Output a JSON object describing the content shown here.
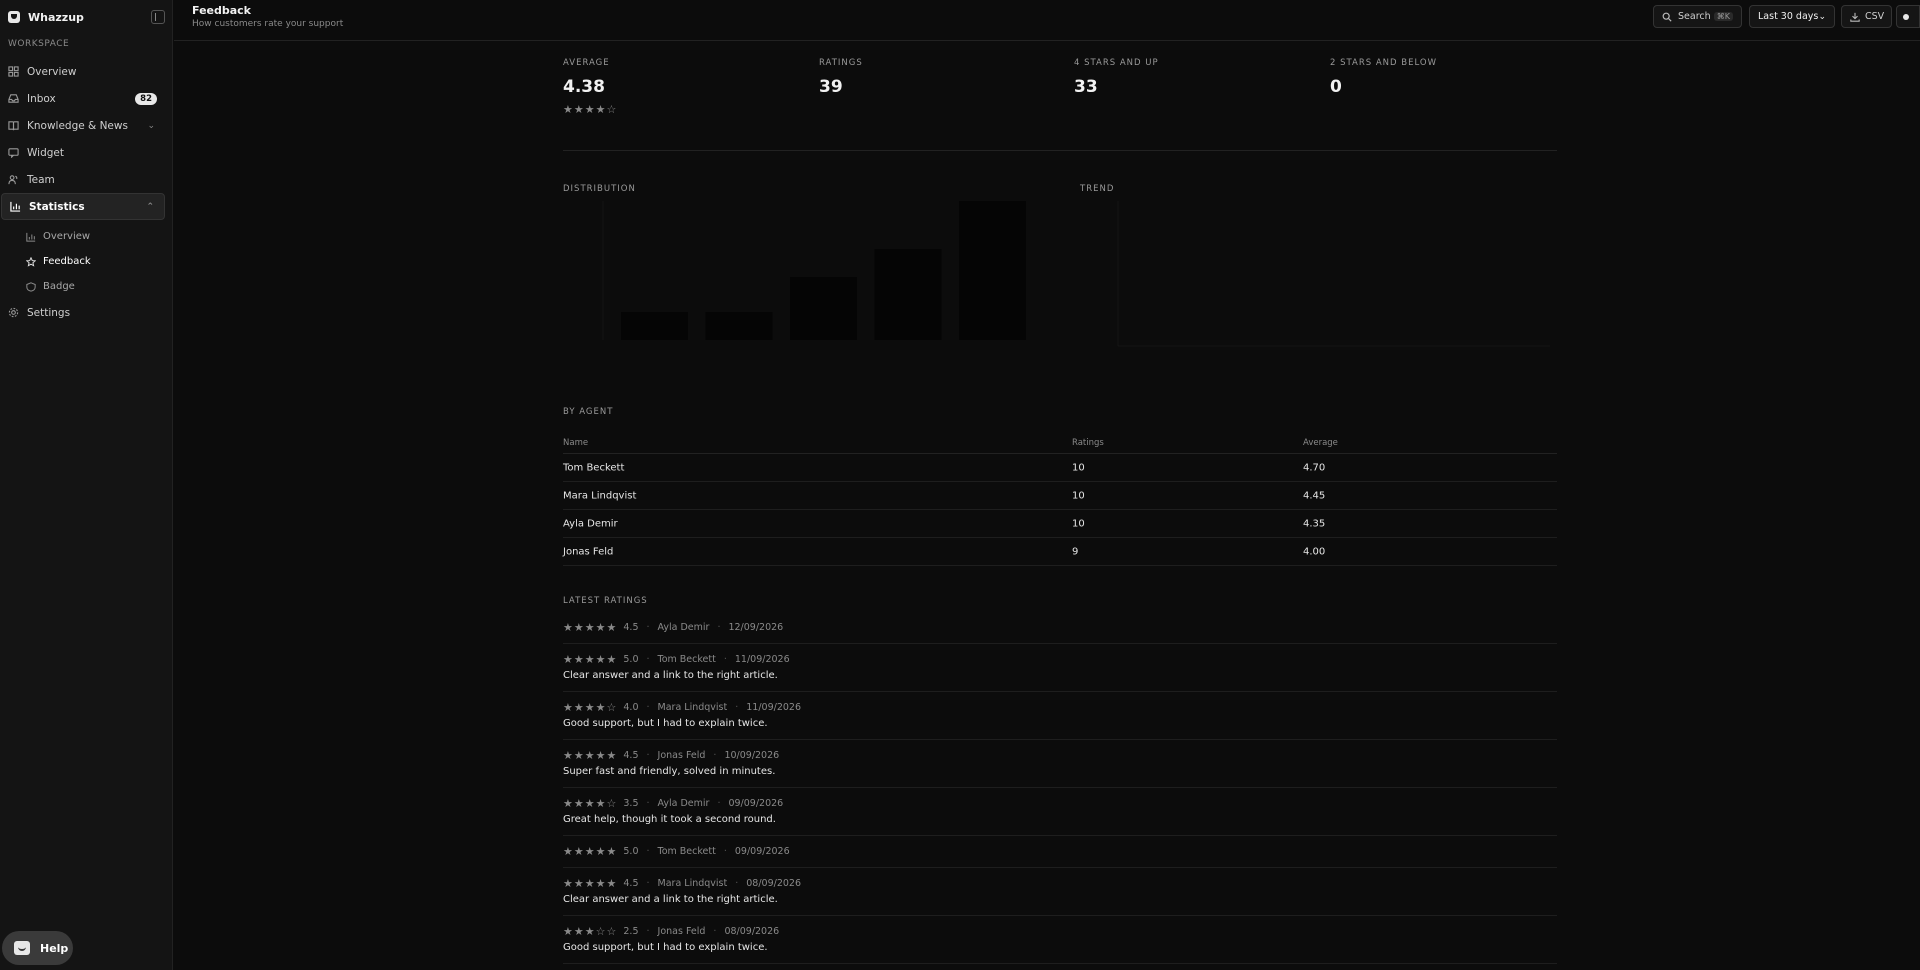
{
  "sidebar": {
    "brand": "Whazzup",
    "workspace_label": "WORKSPACE",
    "items": [
      {
        "label": "Overview"
      },
      {
        "label": "Inbox",
        "badge": "82"
      },
      {
        "label": "Knowledge & News"
      },
      {
        "label": "Widget"
      },
      {
        "label": "Team"
      },
      {
        "label": "Statistics"
      },
      {
        "label": "Settings"
      }
    ],
    "sub_items": [
      {
        "label": "Overview"
      },
      {
        "label": "Feedback"
      },
      {
        "label": "Badge"
      }
    ],
    "help_label": "Help"
  },
  "header": {
    "title": "Feedback",
    "subtitle": "How customers rate your support",
    "search_label": "Search",
    "search_shortcut": "⌘K",
    "range_label": "Last 30 days",
    "csv_label": "CSV"
  },
  "stats": [
    {
      "label": "AVERAGE",
      "value": "4.38",
      "stars": 4
    },
    {
      "label": "RATINGS",
      "value": "39"
    },
    {
      "label": "4 STARS AND UP",
      "value": "33"
    },
    {
      "label": "2 STARS AND BELOW",
      "value": "0"
    }
  ],
  "sections": {
    "distribution": "DISTRIBUTION",
    "trend": "TREND",
    "by_agent": "BY AGENT",
    "latest": "LATEST RATINGS"
  },
  "chart_data": [
    {
      "type": "bar",
      "categories": [
        "",
        "",
        "",
        "",
        ""
      ],
      "values": [
        4,
        4,
        9,
        13,
        20
      ],
      "ylim": [
        0,
        20
      ],
      "bar_color": "#050505",
      "grid": false
    },
    {
      "type": "line",
      "x": [
        "",
        "",
        "",
        "",
        "",
        ""
      ],
      "values": [],
      "grid": false
    }
  ],
  "agents_table": {
    "headers": [
      "Name",
      "Ratings",
      "Average"
    ],
    "rows": [
      [
        "Tom Beckett",
        "10",
        "4.70"
      ],
      [
        "Mara Lindqvist",
        "10",
        "4.45"
      ],
      [
        "Ayla Demir",
        "10",
        "4.35"
      ],
      [
        "Jonas Feld",
        "9",
        "4.00"
      ]
    ]
  },
  "latest_ratings": [
    {
      "stars": 4.5,
      "score": "4.5",
      "agent": "Ayla Demir",
      "date": "12/09/2026",
      "comment": ""
    },
    {
      "stars": 5,
      "score": "5.0",
      "agent": "Tom Beckett",
      "date": "11/09/2026",
      "comment": "Clear answer and a link to the right article."
    },
    {
      "stars": 4,
      "score": "4.0",
      "agent": "Mara Lindqvist",
      "date": "11/09/2026",
      "comment": "Good support, but I had to explain twice."
    },
    {
      "stars": 4.5,
      "score": "4.5",
      "agent": "Jonas Feld",
      "date": "10/09/2026",
      "comment": "Super fast and friendly, solved in minutes."
    },
    {
      "stars": 3.5,
      "score": "3.5",
      "agent": "Ayla Demir",
      "date": "09/09/2026",
      "comment": "Great help, though it took a second round."
    },
    {
      "stars": 5,
      "score": "5.0",
      "agent": "Tom Beckett",
      "date": "09/09/2026",
      "comment": ""
    },
    {
      "stars": 4.5,
      "score": "4.5",
      "agent": "Mara Lindqvist",
      "date": "08/09/2026",
      "comment": "Clear answer and a link to the right article."
    },
    {
      "stars": 2.5,
      "score": "2.5",
      "agent": "Jonas Feld",
      "date": "08/09/2026",
      "comment": "Good support, but I had to explain twice."
    }
  ]
}
